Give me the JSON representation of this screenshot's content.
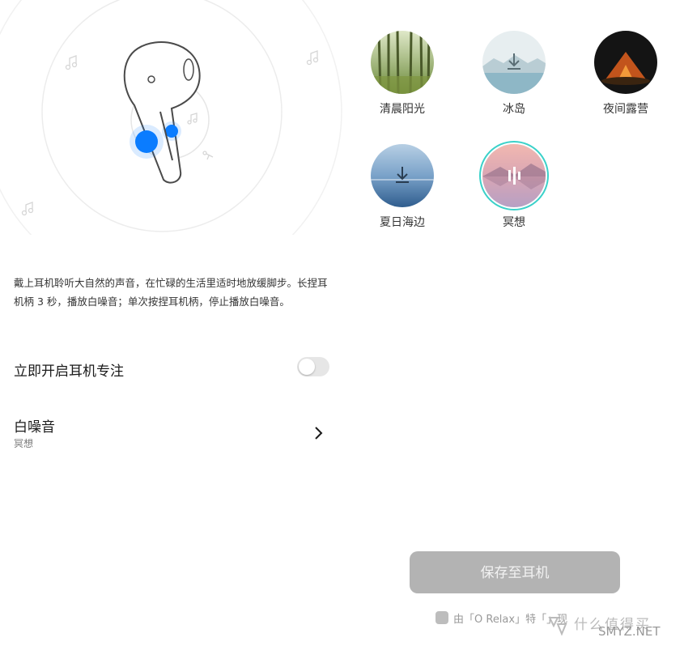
{
  "settings": {
    "description": "戴上耳机聆听大自然的声音，在忙碌的生活里适时地放缓脚步。长捏耳机柄 3 秒，播放白噪音；单次按捏耳机柄，停止播放白噪音。",
    "focus_label": "立即开启耳机专注",
    "focus_enabled": false,
    "noise_title": "白噪音",
    "noise_value": "冥想"
  },
  "sounds": [
    {
      "label": "清晨阳光",
      "icon": "forest-image",
      "state": "downloaded"
    },
    {
      "label": "冰岛",
      "icon": "download-icon",
      "state": "not-downloaded"
    },
    {
      "label": "夜间露营",
      "icon": "tent-image",
      "state": "downloaded"
    },
    {
      "label": "夏日海边",
      "icon": "download-icon",
      "state": "not-downloaded"
    },
    {
      "label": "冥想",
      "icon": "playing-bars-icon",
      "state": "selected"
    }
  ],
  "save_button": "保存至耳机",
  "credit": "由「O Relax」特「」现",
  "watermark": {
    "cn": "什么值得买",
    "en": "SMYZ.NET"
  },
  "colors": {
    "accent_blue": "#0a7cff",
    "selected_ring": "#3ad1c9",
    "button_disabled": "#b3b3b3",
    "toggle_off": "#e6e6e6"
  }
}
